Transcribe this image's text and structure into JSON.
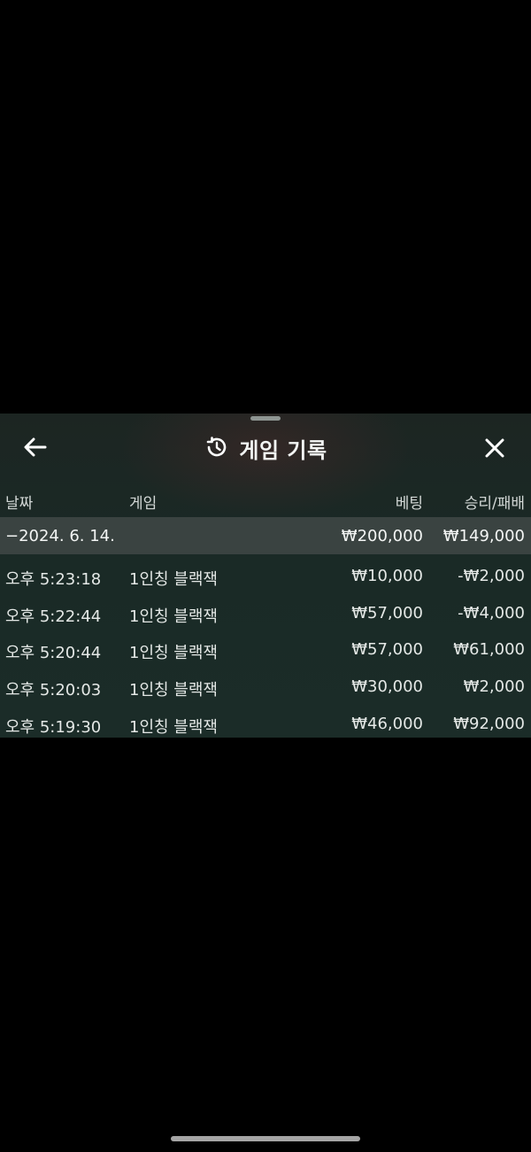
{
  "header": {
    "title": "게임 기록",
    "back_icon": "arrow-left-icon",
    "history_icon": "history-icon",
    "close_icon": "close-icon"
  },
  "columns": {
    "date": "날짜",
    "game": "게임",
    "bet": "베팅",
    "win_loss": "승리/패배"
  },
  "date_group": {
    "date": "−2024. 6. 14.",
    "bet_total": "₩200,000",
    "win_loss_total": "₩149,000"
  },
  "rows": [
    {
      "time": "오후 5:23:18",
      "game": "1인칭 블랙잭",
      "bet": "₩10,000",
      "win_loss": "-₩2,000"
    },
    {
      "time": "오후 5:22:44",
      "game": "1인칭 블랙잭",
      "bet": "₩57,000",
      "win_loss": "-₩4,000"
    },
    {
      "time": "오후 5:20:44",
      "game": "1인칭 블랙잭",
      "bet": "₩57,000",
      "win_loss": "₩61,000"
    },
    {
      "time": "오후 5:20:03",
      "game": "1인칭 블랙잭",
      "bet": "₩30,000",
      "win_loss": "₩2,000"
    },
    {
      "time": "오후 5:19:30",
      "game": "1인칭 블랙잭",
      "bet": "₩46,000",
      "win_loss": "₩92,000"
    }
  ],
  "colors": {
    "background": "#000000",
    "panel": "#1b2926",
    "date_row": "#3a4341",
    "text": "#e8ecea"
  }
}
